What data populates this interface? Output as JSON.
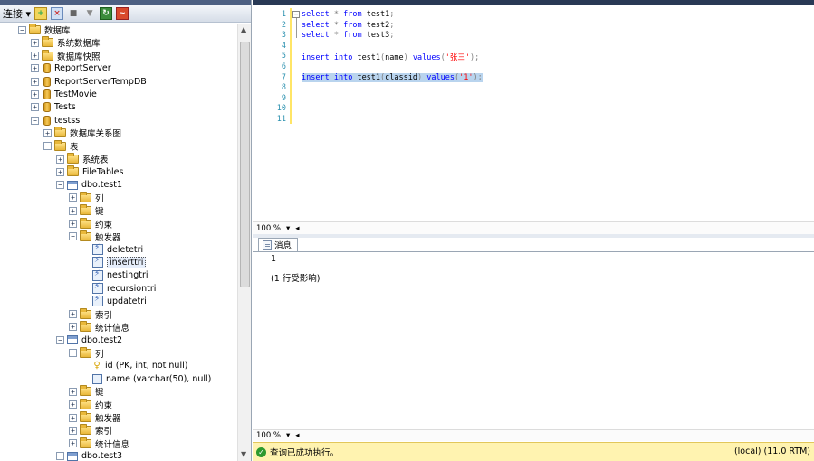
{
  "object_explorer": {
    "toolbar": {
      "connect_label": "连接 ▾"
    },
    "tree": [
      {
        "label": "数据库",
        "icon": "folder",
        "expander": "−",
        "indent": 0
      },
      {
        "label": "系统数据库",
        "icon": "folder",
        "expander": "+",
        "indent": 1
      },
      {
        "label": "数据库快照",
        "icon": "folder",
        "expander": "+",
        "indent": 1
      },
      {
        "label": "ReportServer",
        "icon": "database",
        "expander": "+",
        "indent": 1
      },
      {
        "label": "ReportServerTempDB",
        "icon": "database",
        "expander": "+",
        "indent": 1
      },
      {
        "label": "TestMovie",
        "icon": "database",
        "expander": "+",
        "indent": 1
      },
      {
        "label": "Tests",
        "icon": "database",
        "expander": "+",
        "indent": 1
      },
      {
        "label": "testss",
        "icon": "database",
        "expander": "−",
        "indent": 1
      },
      {
        "label": "数据库关系图",
        "icon": "folder",
        "expander": "+",
        "indent": 2
      },
      {
        "label": "表",
        "icon": "folder",
        "expander": "−",
        "indent": 2
      },
      {
        "label": "系统表",
        "icon": "folder",
        "expander": "+",
        "indent": 3
      },
      {
        "label": "FileTables",
        "icon": "folder",
        "expander": "+",
        "indent": 3
      },
      {
        "label": "dbo.test1",
        "icon": "table",
        "expander": "−",
        "indent": 3
      },
      {
        "label": "列",
        "icon": "folder",
        "expander": "+",
        "indent": 4
      },
      {
        "label": "键",
        "icon": "folder",
        "expander": "+",
        "indent": 4
      },
      {
        "label": "约束",
        "icon": "folder",
        "expander": "+",
        "indent": 4
      },
      {
        "label": "触发器",
        "icon": "folder",
        "expander": "−",
        "indent": 4
      },
      {
        "label": "deletetri",
        "icon": "trigger",
        "expander": "",
        "indent": 5
      },
      {
        "label": "inserttri",
        "icon": "trigger",
        "expander": "",
        "indent": 5,
        "selected": true
      },
      {
        "label": "nestingtri",
        "icon": "trigger",
        "expander": "",
        "indent": 5
      },
      {
        "label": "recursiontri",
        "icon": "trigger",
        "expander": "",
        "indent": 5
      },
      {
        "label": "updatetri",
        "icon": "trigger",
        "expander": "",
        "indent": 5
      },
      {
        "label": "索引",
        "icon": "folder",
        "expander": "+",
        "indent": 4
      },
      {
        "label": "统计信息",
        "icon": "folder",
        "expander": "+",
        "indent": 4
      },
      {
        "label": "dbo.test2",
        "icon": "table",
        "expander": "−",
        "indent": 3
      },
      {
        "label": "列",
        "icon": "folder",
        "expander": "−",
        "indent": 4
      },
      {
        "label": "id (PK, int, not null)",
        "icon": "key",
        "expander": "",
        "indent": 5
      },
      {
        "label": "name (varchar(50), null)",
        "icon": "column",
        "expander": "",
        "indent": 5
      },
      {
        "label": "键",
        "icon": "folder",
        "expander": "+",
        "indent": 4
      },
      {
        "label": "约束",
        "icon": "folder",
        "expander": "+",
        "indent": 4
      },
      {
        "label": "触发器",
        "icon": "folder",
        "expander": "+",
        "indent": 4
      },
      {
        "label": "索引",
        "icon": "folder",
        "expander": "+",
        "indent": 4
      },
      {
        "label": "统计信息",
        "icon": "folder",
        "expander": "+",
        "indent": 4
      },
      {
        "label": "dbo.test3",
        "icon": "table",
        "expander": "−",
        "indent": 3
      }
    ]
  },
  "editor": {
    "line_numbers": [
      "1",
      "2",
      "3",
      "4",
      "5",
      "6",
      "7",
      "8",
      "9",
      "10",
      "11"
    ],
    "lines": [
      [
        {
          "t": "select",
          "c": "kw"
        },
        {
          "t": " ",
          "c": "pln"
        },
        {
          "t": "*",
          "c": "op"
        },
        {
          "t": " ",
          "c": "pln"
        },
        {
          "t": "from",
          "c": "kw"
        },
        {
          "t": " test1",
          "c": "pln"
        },
        {
          "t": ";",
          "c": "op"
        }
      ],
      [
        {
          "t": "select",
          "c": "kw"
        },
        {
          "t": " ",
          "c": "pln"
        },
        {
          "t": "*",
          "c": "op"
        },
        {
          "t": " ",
          "c": "pln"
        },
        {
          "t": "from",
          "c": "kw"
        },
        {
          "t": " test2",
          "c": "pln"
        },
        {
          "t": ";",
          "c": "op"
        }
      ],
      [
        {
          "t": "select",
          "c": "kw"
        },
        {
          "t": " ",
          "c": "pln"
        },
        {
          "t": "*",
          "c": "op"
        },
        {
          "t": " ",
          "c": "pln"
        },
        {
          "t": "from",
          "c": "kw"
        },
        {
          "t": " test3",
          "c": "pln"
        },
        {
          "t": ";",
          "c": "op"
        }
      ],
      [],
      [
        {
          "t": "insert",
          "c": "kw"
        },
        {
          "t": " ",
          "c": "pln"
        },
        {
          "t": "into",
          "c": "kw"
        },
        {
          "t": " test1",
          "c": "pln"
        },
        {
          "t": "(",
          "c": "op"
        },
        {
          "t": "name",
          "c": "pln"
        },
        {
          "t": ")",
          "c": "op"
        },
        {
          "t": " ",
          "c": "pln"
        },
        {
          "t": "values",
          "c": "kw"
        },
        {
          "t": "(",
          "c": "op"
        },
        {
          "t": "'张三'",
          "c": "str"
        },
        {
          "t": ");",
          "c": "op"
        }
      ],
      [],
      [
        {
          "t": "insert",
          "c": "kw"
        },
        {
          "t": " ",
          "c": "pln"
        },
        {
          "t": "into",
          "c": "kw"
        },
        {
          "t": " test1",
          "c": "pln"
        },
        {
          "t": "(",
          "c": "op"
        },
        {
          "t": "classid",
          "c": "pln"
        },
        {
          "t": ")",
          "c": "op"
        },
        {
          "t": " ",
          "c": "pln"
        },
        {
          "t": "values",
          "c": "kw"
        },
        {
          "t": "(",
          "c": "op"
        },
        {
          "t": "'1'",
          "c": "str"
        },
        {
          "t": ");",
          "c": "op"
        }
      ],
      [],
      [],
      [],
      []
    ],
    "selected_line_index": 6,
    "zoom_top": "100 %",
    "zoom_bottom": "100 %"
  },
  "results": {
    "tab_label": "消息",
    "count_line": "1",
    "message": "(1 行受影响)"
  },
  "status": {
    "message": "查询已成功执行。",
    "server": "(local) (11.0 RTM)"
  },
  "colors": {
    "keyword": "#0000ff",
    "string": "#ff0000",
    "line_number": "#2b91af",
    "status_bg": "#fff3b0",
    "selection": "#b9d4ee"
  }
}
